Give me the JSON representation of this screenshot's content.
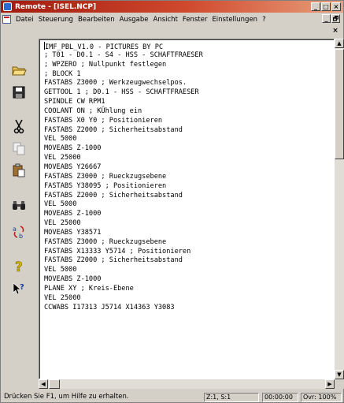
{
  "window": {
    "title": "Remote - [ISEL.NCP]",
    "title_controls": [
      "_",
      "□",
      "×"
    ]
  },
  "menubar": {
    "items": [
      "Datei",
      "Steuerung",
      "Bearbeiten",
      "Ausgabe",
      "Ansicht",
      "Fenster",
      "Einstellungen",
      "?"
    ],
    "mdi_controls": [
      "_",
      "🗗"
    ],
    "close_label": "×"
  },
  "toolbar": {
    "tools": [
      {
        "icon": "open-folder-icon"
      },
      {
        "icon": "save-icon"
      },
      {
        "icon": "cut-icon"
      },
      {
        "icon": "copy-icon"
      },
      {
        "icon": "paste-icon"
      },
      {
        "icon": "find-icon"
      },
      {
        "icon": "replace-icon"
      },
      {
        "icon": "help-icon"
      },
      {
        "icon": "context-help-icon"
      }
    ]
  },
  "editor": {
    "lines": [
      "IMF_PBL_V1.0 - PICTURES BY PC",
      "; T01 - D0.1 - S4 - HSS - SCHAFTFRAESER",
      "; WPZERO ; Nullpunkt festlegen",
      "; BLOCK 1",
      "FASTABS Z3000 ; Werkzeugwechselpos.",
      "GETTOOL 1 ; D0.1 - HSS - SCHAFTFRAESER",
      "SPINDLE CW RPM1",
      "COOLANT ON ; KÜhlung ein",
      "FASTABS X0 Y0 ; Positionieren",
      "FASTABS Z2000 ; Sicherheitsabstand",
      "VEL 5000",
      "MOVEABS Z-1000",
      "VEL 25000",
      "MOVEABS Y26667",
      "FASTABS Z3000 ; Rueckzugsebene",
      "FASTABS Y38095 ; Positionieren",
      "FASTABS Z2000 ; Sicherheitsabstand",
      "VEL 5000",
      "MOVEABS Z-1000",
      "VEL 25000",
      "MOVEABS Y38571",
      "FASTABS Z3000 ; Rueckzugsebene",
      "FASTABS X13333 Y5714 ; Positionieren",
      "FASTABS Z2000 ; Sicherheitsabstand",
      "VEL 5000",
      "MOVEABS Z-1000",
      "PLANE XY ; Kreis-Ebene",
      "VEL 25000",
      "CCWABS I17313 J5714 X14363 Y3083"
    ]
  },
  "statusbar": {
    "message": "Drücken Sie F1, um Hilfe zu erhalten.",
    "position": "Z:1, S:1",
    "time": "00:00:00",
    "mode": "Ovr: 100%"
  }
}
